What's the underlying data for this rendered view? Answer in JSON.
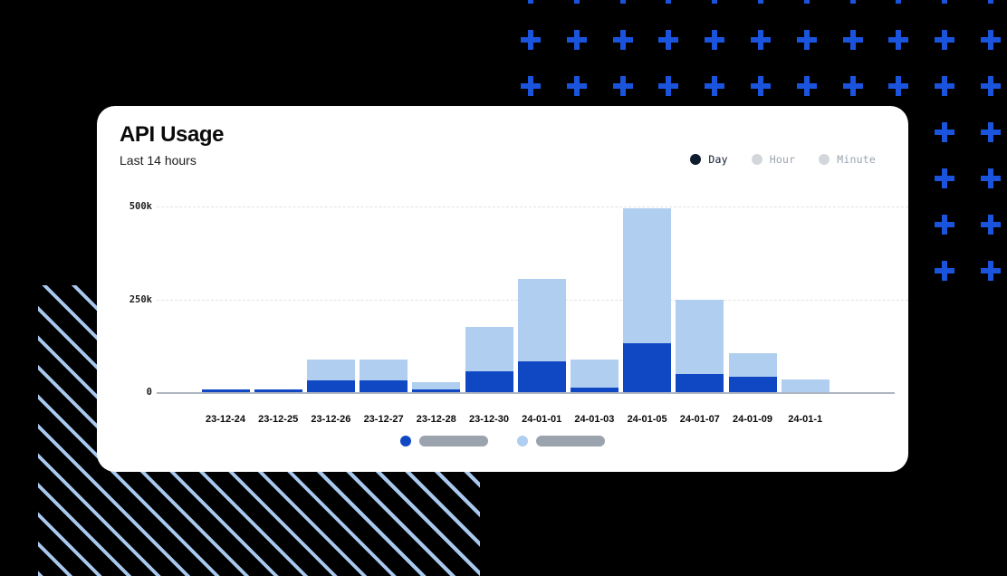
{
  "card": {
    "title": "API Usage",
    "subtitle": "Last 14 hours"
  },
  "legend": {
    "items": [
      {
        "label": "Day",
        "state": "active",
        "dot_color": "#0F1B2E",
        "icon": "legend-dot-icon"
      },
      {
        "label": "Hour",
        "state": "inactive",
        "dot_color": "#D3D7DC",
        "icon": "legend-dot-icon"
      },
      {
        "label": "Minute",
        "state": "inactive",
        "dot_color": "#D3D7DC",
        "icon": "legend-dot-icon"
      }
    ]
  },
  "series_toggles": [
    {
      "dot_color": "#1048C4",
      "icon": "series-dot-icon",
      "pill_color": "#9BA3AE"
    },
    {
      "dot_color": "#AFCEF0",
      "icon": "series-dot-icon",
      "pill_color": "#9BA3AE"
    }
  ],
  "theme": {
    "background": "#000000",
    "card_background": "#FFFFFF",
    "accent_dark_blue": "#1048C4",
    "accent_light_blue": "#AFCEF0",
    "plus_blue": "#1A54DC",
    "stripe_blue": "#A9C8EE",
    "gridline": "#E2E2E2",
    "axis": "#AEB6C2"
  },
  "chart_data": {
    "type": "bar",
    "title": "API Usage",
    "subtitle": "Last 14 hours",
    "xlabel": "",
    "ylabel": "",
    "stacked": true,
    "grid": true,
    "legend_position": "top-right",
    "ylim": [
      0,
      500000
    ],
    "yticks": [
      0,
      250000,
      500000
    ],
    "ytick_labels": [
      "0",
      "250k",
      "500k"
    ],
    "categories": [
      "23-12-24",
      "23-12-25",
      "23-12-26",
      "23-12-27",
      "23-12-28",
      "23-12-30",
      "24-01-01",
      "24-01-03",
      "24-01-05",
      "24-01-07",
      "24-01-09",
      "24-01-1"
    ],
    "series": [
      {
        "name": "Day",
        "color": "#1048C4",
        "values": [
          8000,
          8000,
          32000,
          32000,
          8000,
          57000,
          84000,
          12000,
          131000,
          48000,
          42000,
          0
        ]
      },
      {
        "name": "Hour",
        "color": "#AFCEF0",
        "values": [
          0,
          0,
          57000,
          57000,
          18000,
          118000,
          221000,
          75000,
          364000,
          200000,
          62000,
          35000
        ]
      }
    ],
    "totals": [
      8000,
      8000,
      89000,
      89000,
      26000,
      175000,
      305000,
      87000,
      495000,
      248000,
      104000,
      35000
    ]
  }
}
